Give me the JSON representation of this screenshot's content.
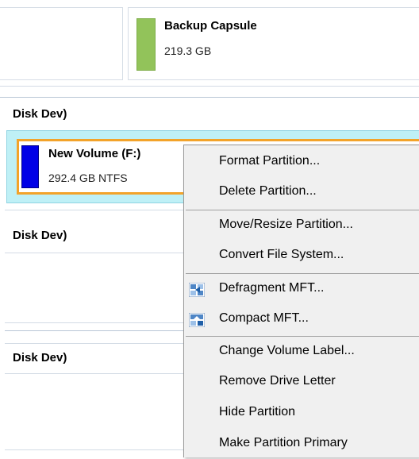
{
  "top_partition": {
    "name": "Backup Capsule",
    "size": "219.3 GB"
  },
  "disks": [
    {
      "label": "Disk Dev)"
    },
    {
      "label": "Disk Dev)"
    },
    {
      "label": "Disk Dev)"
    }
  ],
  "selected_partition": {
    "name": "New Volume (F:)",
    "info": "292.4 GB NTFS"
  },
  "context_menu": {
    "items": [
      {
        "label": "Format Partition...",
        "icon": ""
      },
      {
        "label": "Delete Partition...",
        "icon": ""
      },
      {
        "label": "Move/Resize Partition...",
        "icon": ""
      },
      {
        "label": "Convert File System...",
        "icon": ""
      },
      {
        "label": "Defragment MFT...",
        "icon": "defragment-icon"
      },
      {
        "label": "Compact MFT...",
        "icon": "compact-icon"
      },
      {
        "label": "Change Volume Label...",
        "icon": ""
      },
      {
        "label": "Remove Drive Letter",
        "icon": ""
      },
      {
        "label": "Hide Partition",
        "icon": ""
      },
      {
        "label": "Make Partition Primary",
        "icon": ""
      }
    ]
  },
  "colors": {
    "backup_swatch": "#92c35a",
    "volume_swatch": "#0000e6",
    "selection_border": "#f3a32a",
    "selection_background": "#bff0f6"
  }
}
